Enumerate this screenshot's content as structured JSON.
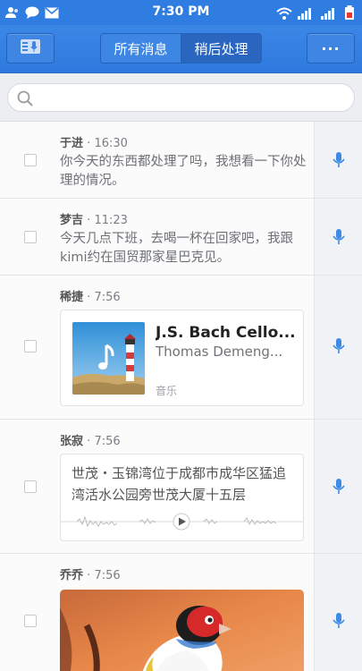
{
  "status_bar": {
    "time": "7:30 PM"
  },
  "header": {
    "tabs": [
      {
        "label": "所有消息",
        "active": false
      },
      {
        "label": "稍后处理",
        "active": true
      }
    ],
    "more_label": "···"
  },
  "search": {
    "placeholder": "",
    "value": ""
  },
  "messages": [
    {
      "sender": "于进",
      "time": "16:30",
      "text": "你今天的东西都处理了吗，我想看一下你处理的情况。"
    },
    {
      "sender": "梦吉",
      "time": "11:23",
      "text": "今天几点下班，去喝一杯在回家吧，我跟kimi约在国贸那家星巴克见。"
    },
    {
      "sender": "稀捷",
      "time": "7:56",
      "music": {
        "title": "J.S. Bach Cello...",
        "artist": "Thomas Demeng...",
        "type": "音乐"
      }
    },
    {
      "sender": "张寂",
      "time": "7:56",
      "location": "世茂・玉锦湾位于成都市成华区猛追湾活水公园旁世茂大厦十五层"
    },
    {
      "sender": "乔乔",
      "time": "7:56"
    }
  ],
  "separator": "·",
  "colors": {
    "accent": "#2f7de1",
    "mic": "#3d8be4"
  }
}
